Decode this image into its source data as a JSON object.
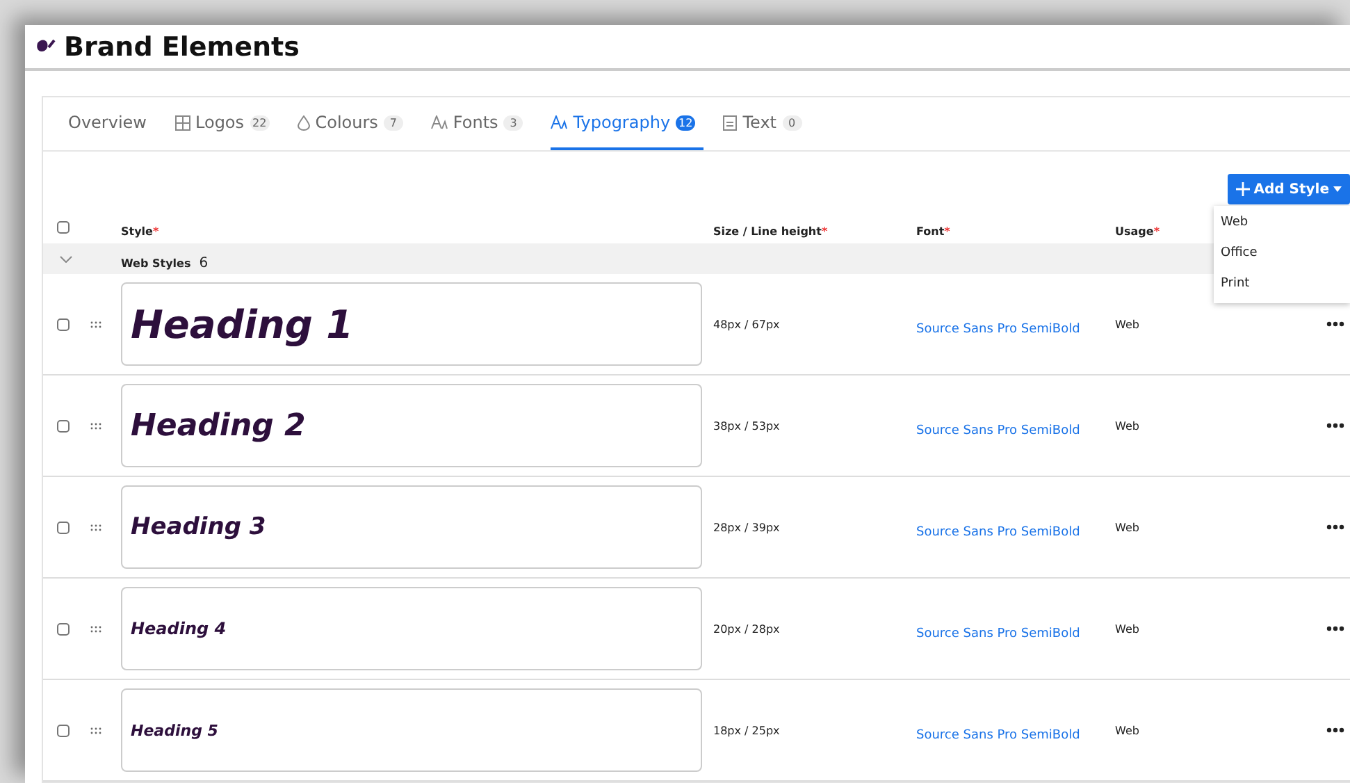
{
  "page": {
    "title": "Brand Elements"
  },
  "tabs": [
    {
      "label": "Overview",
      "selected": false
    },
    {
      "label": "Logos",
      "count": "22",
      "kind": "logos",
      "selected": false
    },
    {
      "label": "Colours",
      "count": "7",
      "kind": "colours",
      "selected": false
    },
    {
      "label": "Fonts",
      "count": "3",
      "kind": "fonts",
      "selected": false
    },
    {
      "label": "Typography",
      "count": "12",
      "kind": "fonts",
      "selected": true
    },
    {
      "label": "Text",
      "count": "0",
      "kind": "text",
      "selected": false
    }
  ],
  "add_button": {
    "label": "Add Style",
    "menu": [
      "Web",
      "Office",
      "Print"
    ]
  },
  "table": {
    "columns": [
      {
        "label": "Style",
        "mark": "*"
      },
      {
        "label": "Size / Line height",
        "mark": "*"
      },
      {
        "label": "Font",
        "mark": "*"
      },
      {
        "label": "Usage",
        "mark": "*"
      }
    ],
    "select_all": {
      "checked": false
    },
    "group": {
      "label": "Web Styles",
      "count": "6",
      "expanded": true
    },
    "rows": [
      {
        "style": "Heading 1",
        "size": "48px / 67px",
        "font": "Source Sans Pro SemiBold",
        "usage": "Web",
        "checked": false
      },
      {
        "style": "Heading 2",
        "size": "38px / 53px",
        "font": "Source Sans Pro SemiBold",
        "usage": "Web",
        "checked": false
      },
      {
        "style": "Heading 3",
        "size": "28px / 39px",
        "font": "Source Sans Pro SemiBold",
        "usage": "Web",
        "checked": false
      },
      {
        "style": "Heading 4",
        "size": "20px / 28px",
        "font": "Source Sans Pro SemiBold",
        "usage": "Web",
        "checked": false
      },
      {
        "style": "Heading 5",
        "size": "18px / 25px",
        "font": "Source Sans Pro SemiBold",
        "usage": "Web",
        "checked": false
      }
    ]
  }
}
